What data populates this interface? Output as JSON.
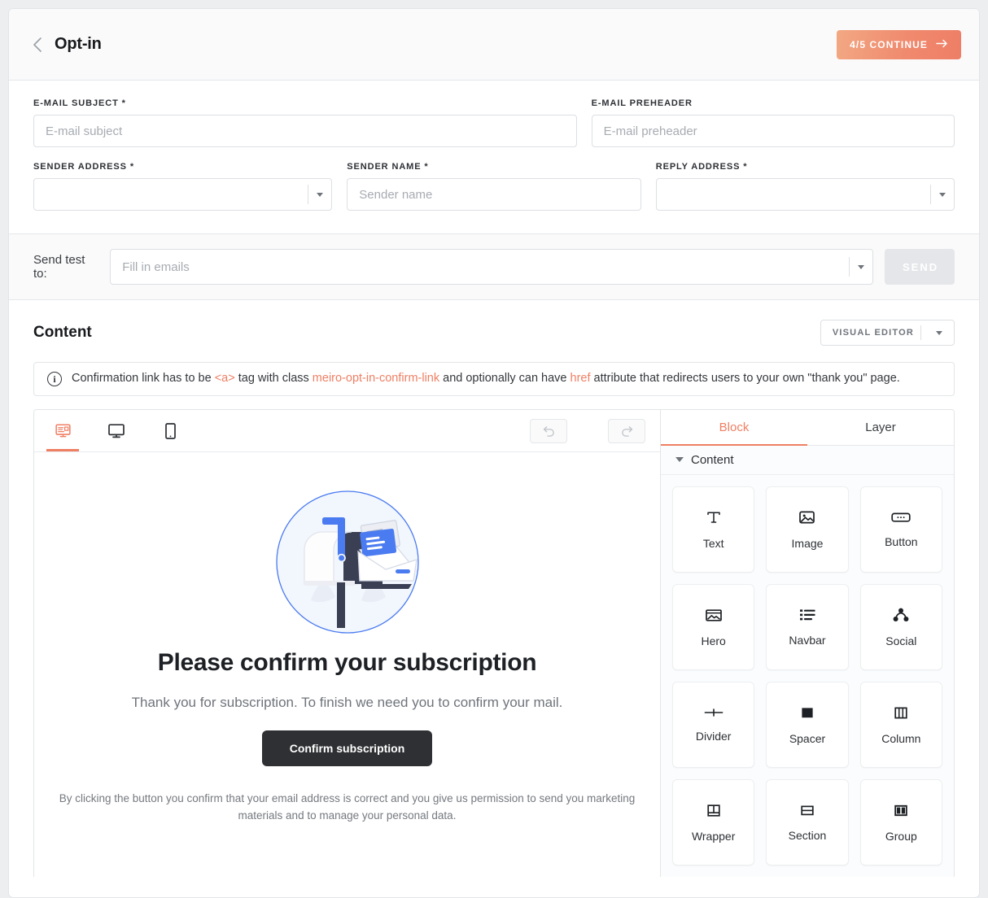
{
  "header": {
    "back_icon": "chevron-left-icon",
    "title": "Opt-in",
    "continue_label": "4/5 CONTINUE",
    "continue_arrow": "→",
    "continue_color": "#ef7f63"
  },
  "form": {
    "email_subject": {
      "label": "E-MAIL SUBJECT *",
      "value": "",
      "placeholder": "E-mail subject"
    },
    "email_preheader": {
      "label": "E-MAIL PREHEADER",
      "value": "",
      "placeholder": "E-mail preheader"
    },
    "sender_address": {
      "label": "SENDER ADDRESS *",
      "value": "",
      "placeholder": ""
    },
    "sender_name": {
      "label": "SENDER NAME *",
      "value": "",
      "placeholder": "Sender name"
    },
    "reply_address": {
      "label": "REPLY ADDRESS *",
      "value": "",
      "placeholder": ""
    }
  },
  "send_test": {
    "label": "Send test to:",
    "input_value": "",
    "input_placeholder": "Fill in emails",
    "send_label": "SEND"
  },
  "content": {
    "title": "Content",
    "editor_mode_label": "VISUAL EDITOR",
    "info": {
      "icon": "info-icon",
      "part1": "Confirmation link has to be ",
      "code1": "<a>",
      "part2": " tag with class ",
      "code2": "meiro-opt-in-confirm-link",
      "part3": " and optionally can have ",
      "code3": "href",
      "part4": " attribute that redirects users to your own \"thank you\" page."
    }
  },
  "canvas": {
    "devices": [
      {
        "name": "newsletter-view",
        "active": true
      },
      {
        "name": "desktop-view",
        "active": false
      },
      {
        "name": "mobile-view",
        "active": false
      }
    ],
    "undo_label": "undo",
    "redo_label": "redo",
    "email": {
      "illustration": "mailbox-illustration",
      "heading": "Please confirm your subscription",
      "subheading": "Thank you for subscription. To finish we need you to confirm your mail.",
      "button_label": "Confirm subscription",
      "fineprint": "By clicking the button you confirm that your email address is correct and you give us permission to send you marketing materials and to manage your personal data."
    }
  },
  "block_pane": {
    "tabs": [
      {
        "label": "Block",
        "active": true
      },
      {
        "label": "Layer",
        "active": false
      }
    ],
    "group_title": "Content",
    "blocks": [
      {
        "label": "Text",
        "icon": "text-icon"
      },
      {
        "label": "Image",
        "icon": "image-icon"
      },
      {
        "label": "Button",
        "icon": "button-icon"
      },
      {
        "label": "Hero",
        "icon": "hero-icon"
      },
      {
        "label": "Navbar",
        "icon": "navbar-icon"
      },
      {
        "label": "Social",
        "icon": "social-icon"
      },
      {
        "label": "Divider",
        "icon": "divider-icon"
      },
      {
        "label": "Spacer",
        "icon": "spacer-icon"
      },
      {
        "label": "Column",
        "icon": "column-icon"
      },
      {
        "label": "Wrapper",
        "icon": "wrapper-icon"
      },
      {
        "label": "Section",
        "icon": "section-icon"
      },
      {
        "label": "Group",
        "icon": "group-icon"
      }
    ]
  }
}
